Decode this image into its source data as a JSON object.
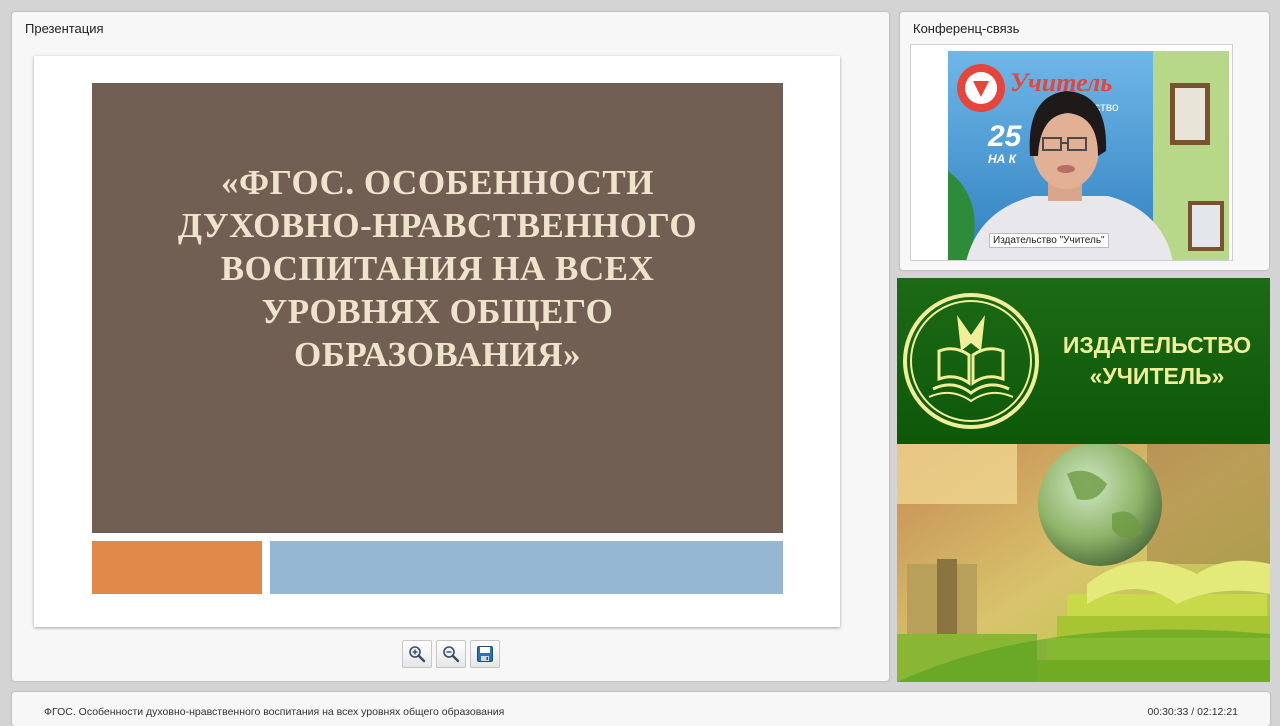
{
  "presentation": {
    "panel_title": "Презентация",
    "slide_title": "«ФГОС. ОСОБЕННОСТИ\nДУХОВНО-НРАВСТВЕННОГО\nВОСПИТАНИЯ НА ВСЕХ\nУРОВНЯХ ОБЩЕГО\nОБРАЗОВАНИЯ»",
    "colors": {
      "slide_bg": "#715f53",
      "accent_orange": "#e0894a",
      "accent_blue": "#95b7d3"
    },
    "toolbar_icons": [
      "zoom-in-icon",
      "zoom-out-icon",
      "save-icon"
    ]
  },
  "conference": {
    "panel_title": "Конференц-связь",
    "caption": "Издательство \"Учитель\"",
    "backdrop_text": "Учитель",
    "backdrop_sub": "ьство",
    "backdrop_num": "25",
    "backdrop_line": "НА К"
  },
  "banner": {
    "name": "ИЗДАТЕЛЬСТВО\n«УЧИТЕЛЬ»"
  },
  "footer": {
    "title": "ФГОС. Особенности духовно-нравственного воспитания на всех уровнях общего образования",
    "time": "00:30:33 / 02:12:21"
  }
}
